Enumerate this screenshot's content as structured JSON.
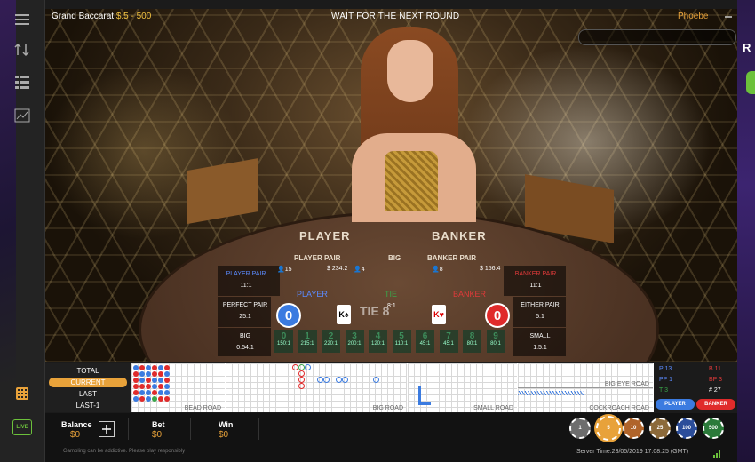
{
  "header": {
    "table_name": "Grand Baccarat",
    "limits": "$.5 - 500",
    "status": "WAIT FOR THE NEXT ROUND",
    "username": "Phoebe"
  },
  "felt": {
    "player": "PLAYER",
    "banker": "BANKER",
    "player_pair": "PLAYER PAIR",
    "player_pair_odds": "11 : 1",
    "big": "BIG",
    "big_odds": "0.54 : 1",
    "banker_pair": "BANKER PAIR",
    "banker_pair_odds": "11 : 1",
    "perfect_pair": "PERFECT PAIR",
    "perfect_pair_odds": "25 : 1",
    "small": "SMALL",
    "small_odds": "1.5 : 1",
    "either_pair": "EITHER PAIR",
    "either_pair_odds": "5 : 1",
    "tie8": "TIE 8"
  },
  "betpanel": {
    "player_pair_label": "PLAYER PAIR",
    "player_pair_odds": "11:1",
    "banker_pair_label": "BANKER PAIR",
    "banker_pair_odds": "11:1",
    "players_left": "15",
    "amount_left": "$ 234.2",
    "players_mid": "4",
    "players_right": "8",
    "amount_right": "$ 156.4",
    "player_label": "PLAYER",
    "tie_label": "TIE",
    "banker_label": "BANKER",
    "perfect_pair_label": "PERFECT PAIR",
    "perfect_pair_odds": "25:1",
    "tie_odds": "8:1",
    "either_pair_label": "EITHER PAIR",
    "either_pair_odds": "5:1",
    "player_score": "0",
    "banker_score": "0",
    "player_card": "K♠",
    "banker_card": "K♥",
    "big_label": "BIG",
    "big_odds": "0.54:1",
    "small_label": "SMALL",
    "small_odds": "1.5:1",
    "tie_numbers": [
      {
        "d": "0",
        "o": "150:1"
      },
      {
        "d": "1",
        "o": "215:1"
      },
      {
        "d": "2",
        "o": "220:1"
      },
      {
        "d": "3",
        "o": "200:1"
      },
      {
        "d": "4",
        "o": "120:1"
      },
      {
        "d": "5",
        "o": "110:1"
      },
      {
        "d": "6",
        "o": "45:1"
      },
      {
        "d": "7",
        "o": "45:1"
      },
      {
        "d": "8",
        "o": "80:1"
      },
      {
        "d": "9",
        "o": "80:1"
      }
    ]
  },
  "roads": {
    "total": "TOTAL",
    "current": "CURRENT",
    "last": "LAST",
    "last1": "LAST-1",
    "bead_road": "BEAD ROAD",
    "big_road": "BIG ROAD",
    "small_road": "SMALL ROAD",
    "big_eye_road": "BIG EYE ROAD",
    "cockroach_road": "COCKROACH ROAD"
  },
  "stats": {
    "p_label": "P",
    "p_val": "13",
    "b_label": "B",
    "b_val": "11",
    "pp_label": "PP",
    "pp_val": "1",
    "bp_label": "BP",
    "bp_val": "3",
    "t_label": "T",
    "t_val": "3",
    "hash_label": "#",
    "hash_val": "27",
    "player_btn": "PLAYER",
    "banker_btn": "BANKER"
  },
  "bottom": {
    "balance_label": "Balance",
    "balance_value": "$0",
    "bet_label": "Bet",
    "bet_value": "$0",
    "win_label": "Win",
    "win_value": "$0",
    "live": "LIVE",
    "gambling_note": "Gambling can be addictive. Please play responsibly",
    "server_time": "Server Time:23/05/2019 17:08:25 (GMT)",
    "chips": [
      "1",
      "5",
      "10",
      "25",
      "100",
      "500"
    ]
  },
  "side": {
    "letter": "R"
  },
  "colors": {
    "player": "#3b7be0",
    "banker": "#e02b2b",
    "tie": "#3aa64a",
    "accent": "#e8a23a"
  }
}
